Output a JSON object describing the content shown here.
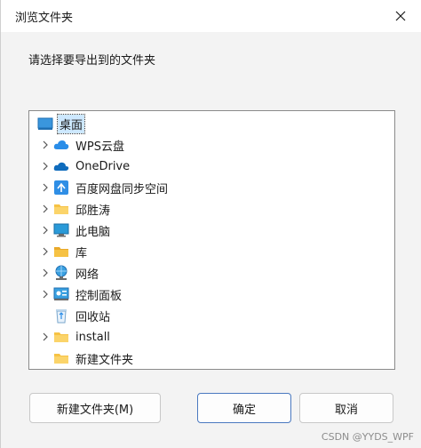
{
  "dialog": {
    "title": "浏览文件夹",
    "instruction": "请选择要导出到的文件夹"
  },
  "tree": {
    "items": [
      {
        "label": "桌面",
        "icon": "desktop-icon",
        "expandable": false,
        "selected": true,
        "indent": 0
      },
      {
        "label": "WPS云盘",
        "icon": "cloud-icon",
        "expandable": true,
        "selected": false,
        "indent": 1
      },
      {
        "label": "OneDrive",
        "icon": "onedrive-icon",
        "expandable": true,
        "selected": false,
        "indent": 1
      },
      {
        "label": "百度网盘同步空间",
        "icon": "baidu-sync-icon",
        "expandable": true,
        "selected": false,
        "indent": 1
      },
      {
        "label": "邱胜涛",
        "icon": "folder-icon",
        "expandable": true,
        "selected": false,
        "indent": 1
      },
      {
        "label": "此电脑",
        "icon": "computer-icon",
        "expandable": true,
        "selected": false,
        "indent": 1
      },
      {
        "label": "库",
        "icon": "library-icon",
        "expandable": true,
        "selected": false,
        "indent": 1
      },
      {
        "label": "网络",
        "icon": "network-icon",
        "expandable": true,
        "selected": false,
        "indent": 1
      },
      {
        "label": "控制面板",
        "icon": "control-panel-icon",
        "expandable": true,
        "selected": false,
        "indent": 1
      },
      {
        "label": "回收站",
        "icon": "recycle-bin-icon",
        "expandable": false,
        "selected": false,
        "indent": 1
      },
      {
        "label": "install",
        "icon": "folder-icon",
        "expandable": true,
        "selected": false,
        "indent": 1
      },
      {
        "label": "新建文件夹",
        "icon": "folder-icon",
        "expandable": false,
        "selected": false,
        "indent": 1
      }
    ]
  },
  "buttons": {
    "new_folder": "新建文件夹(M)",
    "ok": "确定",
    "cancel": "取消"
  },
  "watermark": "CSDN @YYDS_WPF",
  "colors": {
    "accent": "#4a79c0",
    "selection": "#cde8ff",
    "folder": "#f6c244"
  }
}
